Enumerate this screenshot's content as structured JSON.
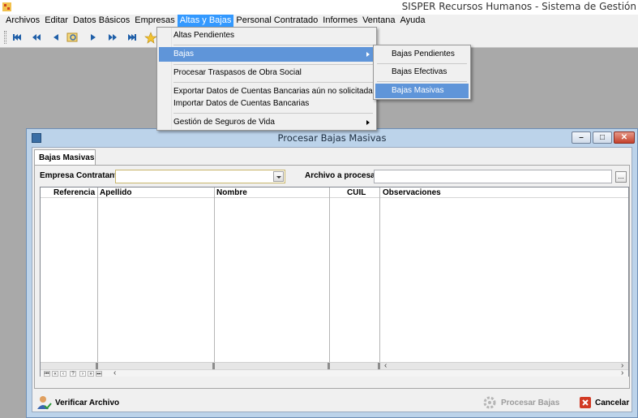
{
  "window": {
    "title": "SISPER Recursos Humanos - Sistema de Gestión"
  },
  "menubar": [
    {
      "label": "Archivos"
    },
    {
      "label": "Editar"
    },
    {
      "label": "Datos Básicos"
    },
    {
      "label": "Empresas"
    },
    {
      "label": "Altas y Bajas",
      "active": true
    },
    {
      "label": "Personal Contratado"
    },
    {
      "label": "Informes"
    },
    {
      "label": "Ventana"
    },
    {
      "label": "Ayuda"
    }
  ],
  "toolbar": {
    "buttons": [
      "first-record-icon",
      "previous-page-icon",
      "previous-record-icon",
      "search-icon",
      "next-record-icon",
      "next-page-icon",
      "last-record-icon",
      "star-icon"
    ]
  },
  "altas_bajas_menu": {
    "altas_pendientes": "Altas Pendientes",
    "bajas": "Bajas",
    "procesar_traspasos": "Procesar Traspasos de Obra Social",
    "exportar_cuentas": "Exportar Datos de Cuentas Bancarias aún no solicitadas",
    "importar_cuentas": "Importar Datos de Cuentas Bancarias",
    "gestion_seguros": "Gestión de Seguros de Vida"
  },
  "bajas_submenu": {
    "pendientes": "Bajas Pendientes",
    "efectivas": "Bajas Efectivas",
    "masivas": "Bajas Masivas"
  },
  "dialog": {
    "title": "Procesar Bajas Masivas",
    "tab": "Bajas Masivas",
    "empresa_label": "Empresa Contratante:",
    "empresa_value": "",
    "archivo_label": "Archivo a procesar:",
    "archivo_value": "",
    "ellipsis": "...",
    "columns": {
      "referencia": "Referencia",
      "apellido": "Apellido",
      "nombre": "Nombre",
      "cuil": "CUIL",
      "observaciones": "Observaciones"
    },
    "verificar_label": "Verificar Archivo",
    "procesar_label": "Procesar Bajas",
    "cancelar_label": "Cancelar"
  },
  "colors": {
    "menu_highlight": "#5f95d9",
    "active_menubar": "#3399ff",
    "dialog_frame": "#bcd3ea",
    "close_button": "#c4412c"
  }
}
